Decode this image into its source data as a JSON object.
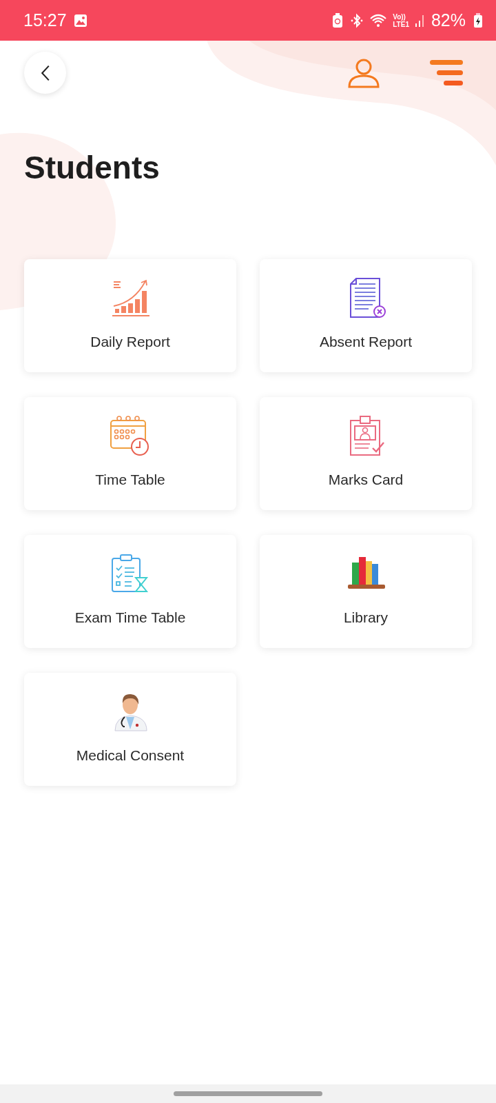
{
  "status_bar": {
    "time": "15:27",
    "volte": "Vo))",
    "network": "LTE1",
    "battery": "82%"
  },
  "title": "Students",
  "tiles": [
    {
      "label": "Daily Report",
      "kind": "growth"
    },
    {
      "label": "Absent Report",
      "kind": "absent"
    },
    {
      "label": "Time Table",
      "kind": "calendar"
    },
    {
      "label": "Marks Card",
      "kind": "idcard"
    },
    {
      "label": "Exam Time Table",
      "kind": "exam"
    },
    {
      "label": "Library",
      "kind": "books"
    },
    {
      "label": "Medical Consent",
      "kind": "doctor"
    }
  ]
}
